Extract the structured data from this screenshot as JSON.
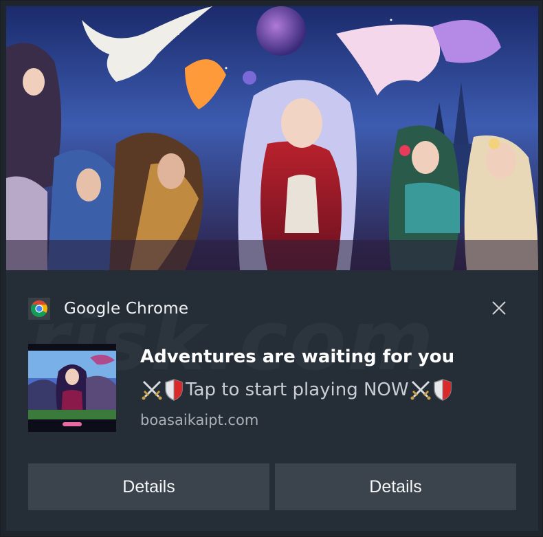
{
  "notification": {
    "app_name": "Google Chrome",
    "title": "Adventures are waiting for you",
    "body_icons": [
      "crossed-swords-icon",
      "shield-icon"
    ],
    "body": "Tap to start playing NOW",
    "source": "boasaikaipt.com",
    "buttons": [
      {
        "label": "Details"
      },
      {
        "label": "Details"
      }
    ],
    "colors": {
      "panel": "#252d36",
      "button": "#3b434c",
      "title": "#ffffff",
      "body": "#c9ced4"
    }
  }
}
